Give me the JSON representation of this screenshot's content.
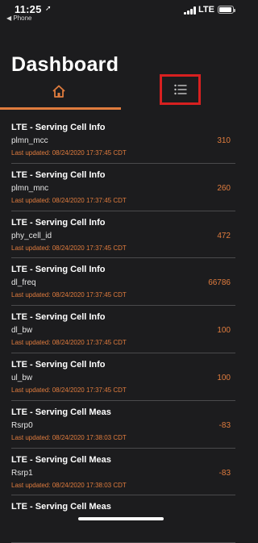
{
  "status_bar": {
    "time": "11:25",
    "back_label": "◀ Phone",
    "carrier": "LTE"
  },
  "header": {
    "title": "Dashboard"
  },
  "tabs": [
    {
      "icon": "home-icon",
      "active": true
    },
    {
      "icon": "list-icon",
      "active": false,
      "highlighted": true
    }
  ],
  "colors": {
    "background": "#1c1c1e",
    "accent": "#e07c3e",
    "highlight_box": "#d72020",
    "divider": "#4a4a4c"
  },
  "items": [
    {
      "title": "LTE - Serving Cell Info",
      "param": "plmn_mcc",
      "updated": "Last updated: 08/24/2020 17:37:45 CDT",
      "value": "310"
    },
    {
      "title": "LTE - Serving Cell Info",
      "param": "plmn_mnc",
      "updated": "Last updated: 08/24/2020 17:37:45 CDT",
      "value": "260"
    },
    {
      "title": "LTE - Serving Cell Info",
      "param": "phy_cell_id",
      "updated": "Last updated: 08/24/2020 17:37:45 CDT",
      "value": "472"
    },
    {
      "title": "LTE - Serving Cell Info",
      "param": "dl_freq",
      "updated": "Last updated: 08/24/2020 17:37:45 CDT",
      "value": "66786"
    },
    {
      "title": "LTE - Serving Cell Info",
      "param": "dl_bw",
      "updated": "Last updated: 08/24/2020 17:37:45 CDT",
      "value": "100"
    },
    {
      "title": "LTE - Serving Cell Info",
      "param": "ul_bw",
      "updated": "Last updated: 08/24/2020 17:37:45 CDT",
      "value": "100"
    },
    {
      "title": "LTE - Serving Cell Meas",
      "param": "Rsrp0",
      "updated": "Last updated: 08/24/2020 17:38:03 CDT",
      "value": "-83"
    },
    {
      "title": "LTE - Serving Cell Meas",
      "param": "Rsrp1",
      "updated": "Last updated: 08/24/2020 17:38:03 CDT",
      "value": "-83"
    },
    {
      "title": "LTE - Serving Cell Meas",
      "param": "",
      "updated": "",
      "value": ""
    }
  ]
}
